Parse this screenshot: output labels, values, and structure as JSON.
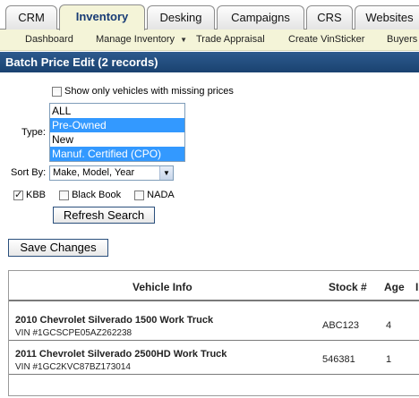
{
  "tabs": [
    {
      "label": "CRM",
      "active": false
    },
    {
      "label": "Inventory",
      "active": true
    },
    {
      "label": "Desking",
      "active": false
    },
    {
      "label": "Campaigns",
      "active": false
    },
    {
      "label": "CRS",
      "active": false
    },
    {
      "label": "Websites",
      "active": false
    }
  ],
  "subnav": {
    "items": [
      "Dashboard",
      "Manage Inventory",
      "Trade Appraisal",
      "Create VinSticker",
      "Buyers"
    ]
  },
  "page": {
    "title": "Batch Price Edit (2 records)"
  },
  "filters": {
    "missing_prices_label": "Show only vehicles with missing prices",
    "missing_prices_checked": false,
    "type_label": "Type:",
    "type_options": [
      {
        "label": "ALL",
        "selected": false
      },
      {
        "label": "Pre-Owned",
        "selected": true
      },
      {
        "label": "New",
        "selected": false
      },
      {
        "label": "Manuf. Certified (CPO)",
        "selected": true
      }
    ],
    "sort_label": "Sort By:",
    "sort_value": "Make, Model, Year",
    "sources": [
      {
        "label": "KBB",
        "checked": true
      },
      {
        "label": "Black Book",
        "checked": false
      },
      {
        "label": "NADA",
        "checked": false
      }
    ],
    "refresh_label": "Refresh Search"
  },
  "actions": {
    "save_label": "Save Changes"
  },
  "table": {
    "headers": {
      "vehicle": "Vehicle Info",
      "stock": "Stock #",
      "age": "Age",
      "extra": "I"
    },
    "rows": [
      {
        "name": "2010 Chevrolet Silverado 1500 Work Truck",
        "vin": "VIN #1GCSCPE05AZ262238",
        "stock": "ABC123",
        "age": "4"
      },
      {
        "name": "2011 Chevrolet Silverado 2500HD Work Truck",
        "vin": "VIN #1GC2KVC87BZ173014",
        "stock": "546381",
        "age": "1"
      }
    ]
  },
  "colors": {
    "title_bar": "#1f4a7c",
    "subnav_bg": "#f4f4d8",
    "selection": "#3399ff",
    "active_tab_text": "#173b75"
  }
}
